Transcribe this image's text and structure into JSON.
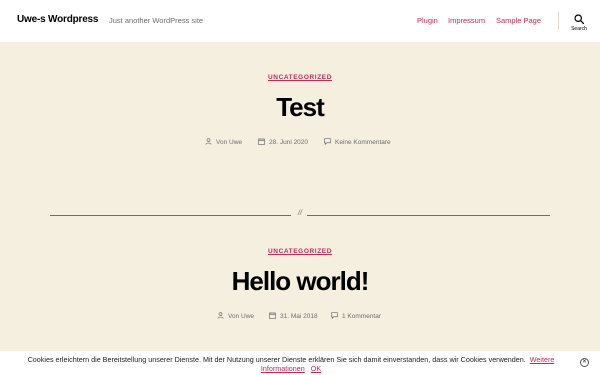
{
  "header": {
    "site_title": "Uwe-s Wordpress",
    "site_description": "Just another WordPress site",
    "nav": [
      "Plugin",
      "Impressum",
      "Sample Page"
    ],
    "search_label": "Search"
  },
  "colors": {
    "accent": "#cd2653",
    "background": "#f5efe0",
    "header_bg": "#ffffff",
    "meta_text": "#6d6d6d"
  },
  "posts": [
    {
      "category": "UNCATEGORIZED",
      "title": "Test",
      "author": "Von Uwe",
      "date": "28. Juni 2020",
      "comments": "Keine Kommentare"
    },
    {
      "category": "UNCATEGORIZED",
      "title": "Hello world!",
      "author": "Von Uwe",
      "date": "31. Mai 2018",
      "comments": "1 Kommentar"
    }
  ],
  "separator_mark": "//",
  "cookie": {
    "text": "Cookies erleichtern die Bereitstellung unserer Dienste. Mit der Nutzung unserer Dienste erklären Sie sich damit einverstanden, dass wir Cookies verwenden.",
    "more_link": "Weitere Informationen",
    "ok_link": "OK",
    "close_symbol": "⊗"
  },
  "icons": {
    "author": "user-icon",
    "date": "calendar-icon",
    "comments": "comment-bubble-icon",
    "search": "search-icon"
  }
}
